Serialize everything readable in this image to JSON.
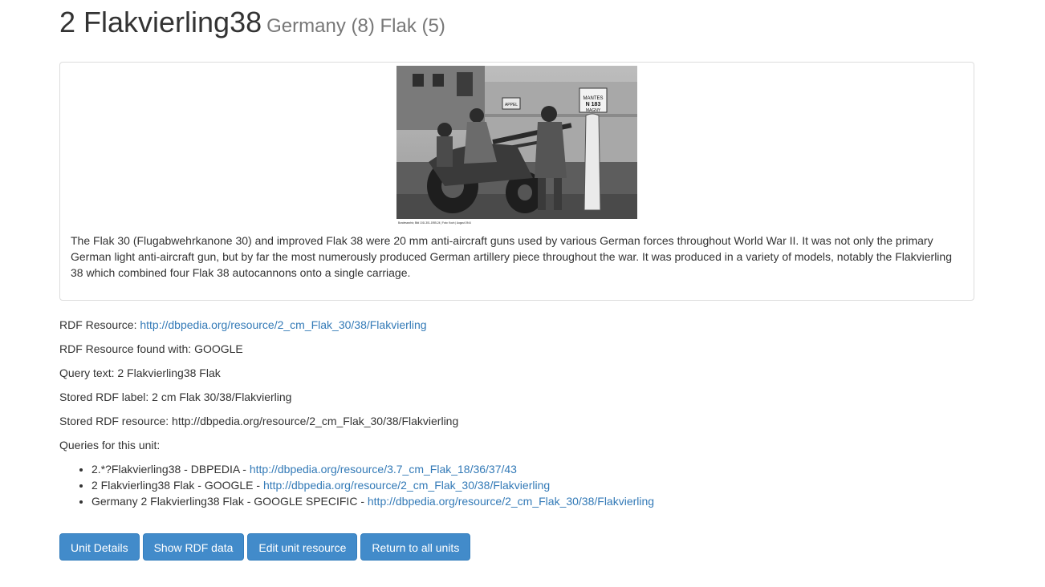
{
  "header": {
    "title": "2 Flakvierling38",
    "subtitle": "Germany (8) Flak (5)"
  },
  "photo": {
    "caption_small": "Bundesarchiv, Bild 101I-301-1955-24 | Foto: Koch | August 1944",
    "sign_top": "APPEL",
    "sign_right_1": "MANTES",
    "sign_right_2": "N 183",
    "sign_right_3": "MAGNY"
  },
  "description": "The Flak 30 (Flugabwehrkanone 30) and improved Flak 38 were 20 mm anti-aircraft guns used by various German forces throughout World War II. It was not only the primary German light anti-aircraft gun, but by far the most numerously produced German artillery piece throughout the war. It was produced in a variety of models, notably the Flakvierling 38 which combined four Flak 38 autocannons onto a single carriage.",
  "info": {
    "rdf_resource_label": "RDF Resource: ",
    "rdf_resource_link": "http://dbpedia.org/resource/2_cm_Flak_30/38/Flakvierling",
    "found_with": "RDF Resource found with: GOOGLE",
    "query_text": "Query text: 2 Flakvierling38 Flak",
    "stored_label": "Stored RDF label: 2 cm Flak 30/38/Flakvierling",
    "stored_resource": "Stored RDF resource: http://dbpedia.org/resource/2_cm_Flak_30/38/Flakvierling",
    "queries_heading": "Queries for this unit:"
  },
  "queries": [
    {
      "text": "2.*?Flakvierling38 - DBPEDIA - ",
      "link": "http://dbpedia.org/resource/3.7_cm_Flak_18/36/37/43"
    },
    {
      "text": "2 Flakvierling38 Flak - GOOGLE - ",
      "link": "http://dbpedia.org/resource/2_cm_Flak_30/38/Flakvierling"
    },
    {
      "text": "Germany 2 Flakvierling38 Flak - GOOGLE SPECIFIC - ",
      "link": "http://dbpedia.org/resource/2_cm_Flak_30/38/Flakvierling"
    }
  ],
  "buttons": {
    "unit_details": "Unit Details",
    "show_rdf": "Show RDF data",
    "edit_resource": "Edit unit resource",
    "return_all": "Return to all units"
  },
  "colors": {
    "link": "#337ab7",
    "button_bg": "#428bca",
    "subtitle": "#777777"
  }
}
